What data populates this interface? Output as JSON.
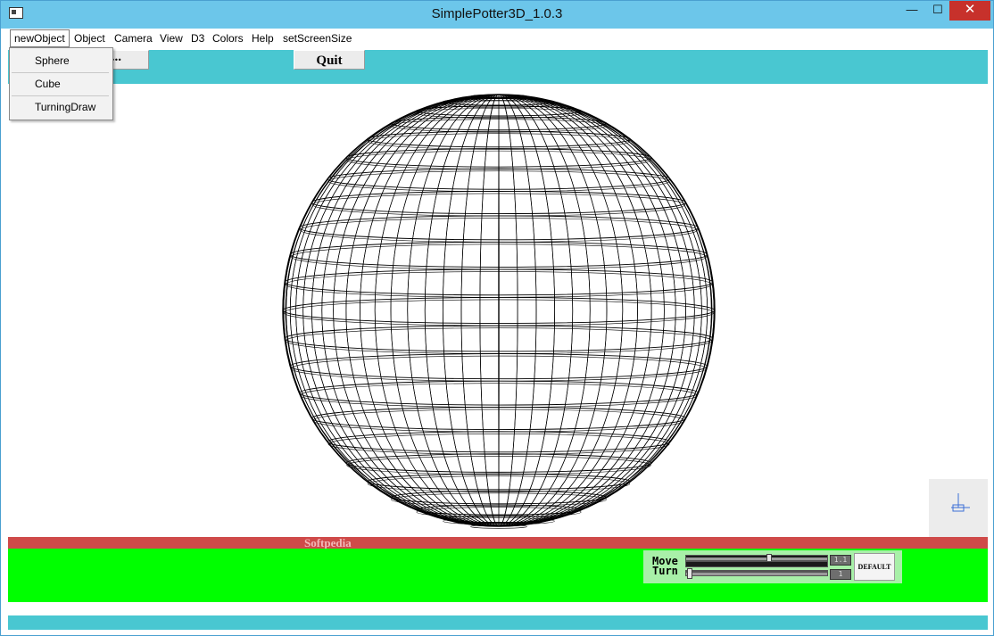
{
  "window": {
    "title": "SimplePotter3D_1.0.3",
    "min_glyph": "—",
    "max_glyph": "☐",
    "close_glyph": "✕"
  },
  "menu": {
    "items": [
      {
        "label": "newObject",
        "open": true
      },
      {
        "label": "Object"
      },
      {
        "label": "Camera"
      },
      {
        "label": "View"
      },
      {
        "label": "D3"
      },
      {
        "label": "Colors"
      },
      {
        "label": "Help"
      },
      {
        "label": "setScreenSize"
      }
    ],
    "dropdown": [
      "Sphere",
      "Cube",
      "TurningDraw"
    ]
  },
  "toolbar": {
    "quit_label": "Quit",
    "partial_label": "..."
  },
  "canvas": {
    "object": "sphere-wireframe",
    "stroke_color": "#000000"
  },
  "status": {
    "watermark": "Softpedia"
  },
  "controls": {
    "move_label": "Move",
    "turn_label": "Turn",
    "move_value": "1.1",
    "turn_value": "1",
    "default_label": "DEFAULT"
  },
  "colors": {
    "titlebar": "#6cc6ea",
    "toolbar": "#49c7d1",
    "redbar": "#cf4a49",
    "greenbar": "#00ff00",
    "close": "#c7312b"
  }
}
